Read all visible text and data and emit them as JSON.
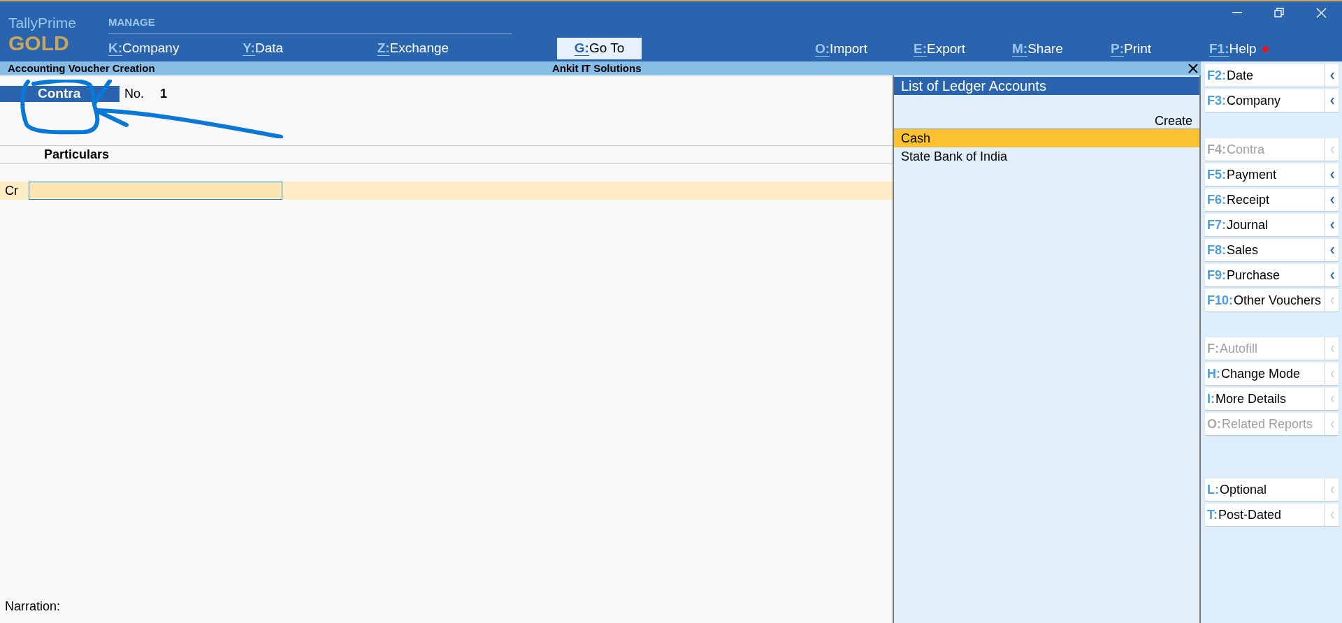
{
  "app": {
    "name": "TallyPrime",
    "edition": "GOLD"
  },
  "menu_group": "MANAGE",
  "menu_left": [
    {
      "key": "K:",
      "label": "Company"
    },
    {
      "key": "Y:",
      "label": "Data"
    },
    {
      "key": "Z:",
      "label": "Exchange"
    }
  ],
  "goto": {
    "key": "G:",
    "label": "Go To"
  },
  "menu_right": [
    {
      "key": "O:",
      "label": "Import",
      "notification": false
    },
    {
      "key": "E:",
      "label": "Export",
      "notification": false
    },
    {
      "key": "M:",
      "label": "Share",
      "notification": false
    },
    {
      "key": "P:",
      "label": "Print",
      "notification": false
    },
    {
      "key": "F1:",
      "label": "Help",
      "notification": true
    }
  ],
  "screen_title": "Accounting Voucher Creation",
  "company": "Ankit IT Solutions",
  "voucher": {
    "type": "Contra",
    "no_label": "No.",
    "number": "1"
  },
  "columns": [
    "Particulars"
  ],
  "entries": [
    {
      "side": "Cr"
    }
  ],
  "narration_label": "Narration:",
  "ledger_list": {
    "title": "List of Ledger Accounts",
    "create": "Create",
    "items": [
      {
        "label": "Cash",
        "selected": true
      },
      {
        "label": "State Bank of India",
        "selected": false
      }
    ]
  },
  "sidebar": [
    [
      {
        "key": "F2:",
        "label": "Date",
        "disabled": false,
        "submenu": true
      },
      {
        "key": "F3:",
        "label": "Company",
        "disabled": false,
        "submenu": true
      }
    ],
    [
      {
        "key": "F4:",
        "label": "Contra",
        "disabled": true,
        "submenu": true
      },
      {
        "key": "F5:",
        "label": "Payment",
        "disabled": false,
        "submenu": true
      },
      {
        "key": "F6:",
        "label": "Receipt",
        "disabled": false,
        "submenu": true
      },
      {
        "key": "F7:",
        "label": "Journal",
        "disabled": false,
        "submenu": true
      },
      {
        "key": "F8:",
        "label": "Sales",
        "disabled": false,
        "submenu": true
      },
      {
        "key": "F9:",
        "label": "Purchase",
        "disabled": false,
        "submenu": true
      },
      {
        "key": "F10:",
        "label": "Other Vouchers",
        "disabled": false,
        "submenu": false
      }
    ],
    [
      {
        "key": "F:",
        "label": "Autofill",
        "disabled": true,
        "submenu": false
      },
      {
        "key": "H:",
        "label": "Change Mode",
        "disabled": false,
        "submenu": false
      },
      {
        "key": "I:",
        "label": "More Details",
        "disabled": false,
        "submenu": false
      },
      {
        "key": "O:",
        "label": "Related Reports",
        "disabled": true,
        "submenu": false
      }
    ],
    [
      {
        "key": "L:",
        "label": "Optional",
        "disabled": false,
        "submenu": false
      },
      {
        "key": "T:",
        "label": "Post-Dated",
        "disabled": false,
        "submenu": false
      }
    ]
  ]
}
